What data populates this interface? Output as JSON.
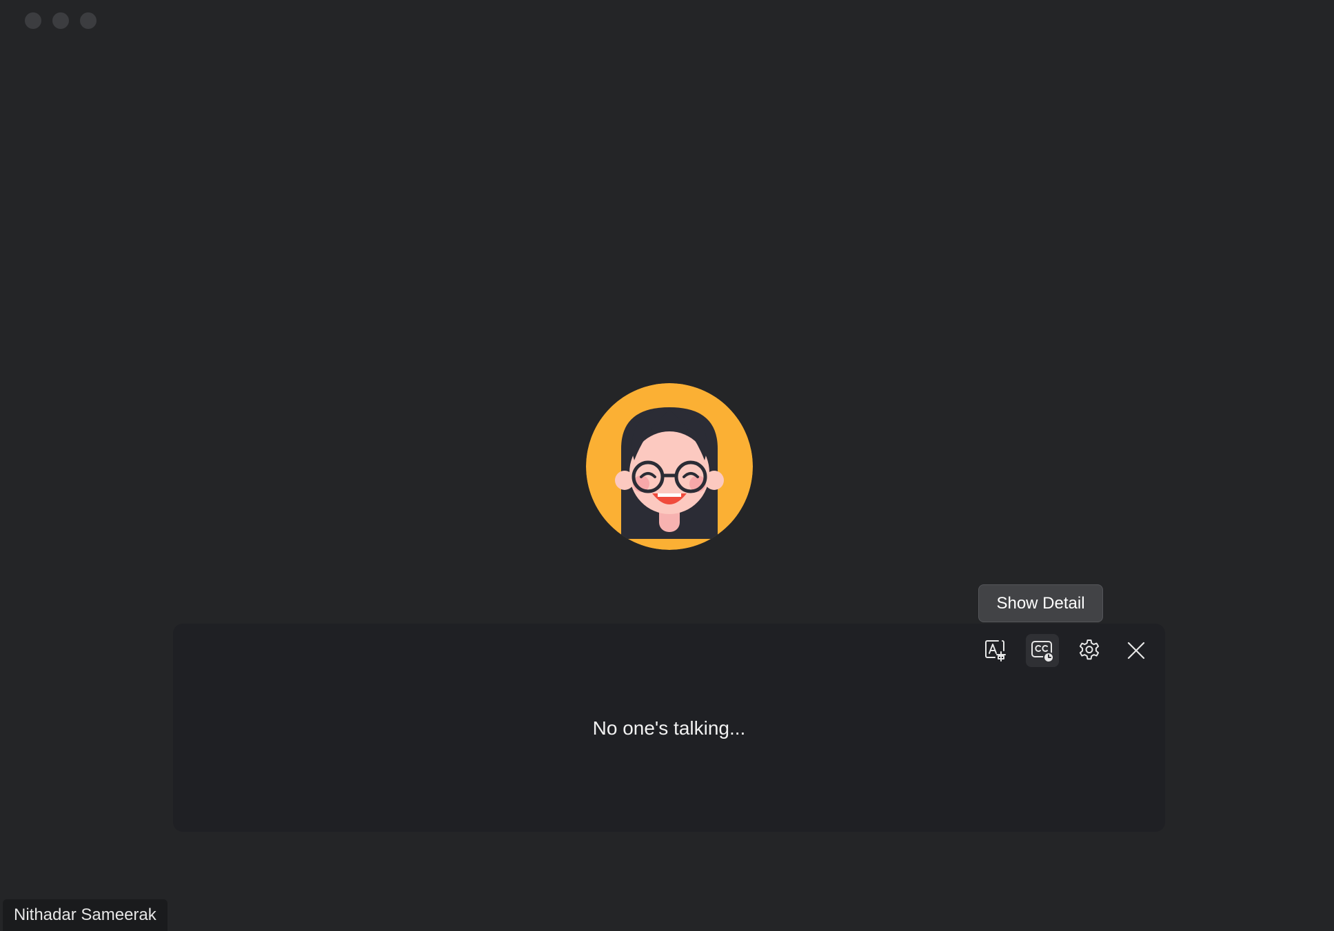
{
  "window": {
    "traffic_lights": [
      "close",
      "minimize",
      "zoom"
    ]
  },
  "participant": {
    "name": "Nithadar Sameerak",
    "avatar_color": "#fbb034"
  },
  "tooltip": {
    "text": "Show Detail"
  },
  "captions": {
    "status_text": "No one's talking...",
    "toolbar": [
      {
        "name": "translate-icon",
        "active": false
      },
      {
        "name": "caption-history-icon",
        "active": true
      },
      {
        "name": "gear-icon",
        "active": false
      },
      {
        "name": "close-icon",
        "active": false
      }
    ]
  },
  "colors": {
    "background": "#242527",
    "panel": "#1f2024",
    "tooltip": "#424346",
    "text": "#f2f2f2"
  }
}
